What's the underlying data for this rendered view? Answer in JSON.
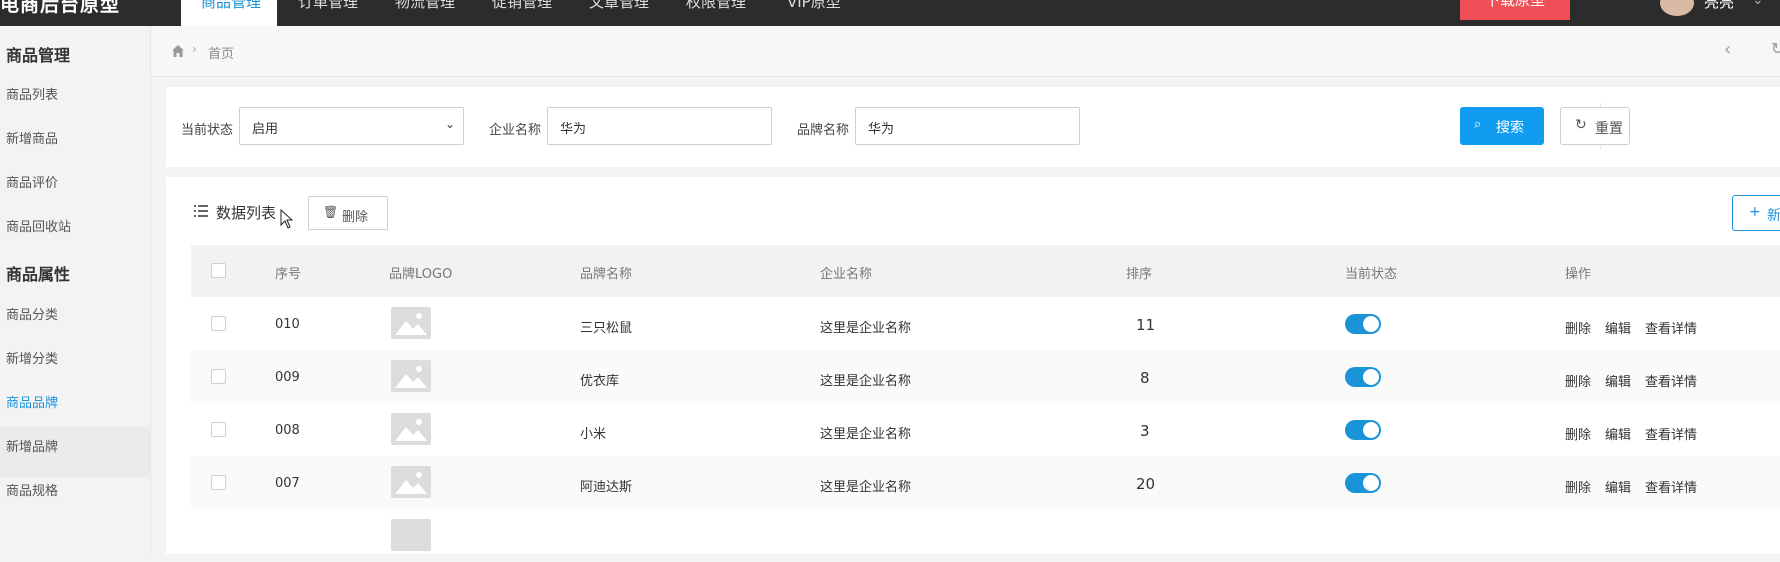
{
  "app": {
    "logo": "电商后台原型",
    "nav_tabs": [
      "商品管理",
      "订单管理",
      "物流管理",
      "促销管理",
      "文章管理",
      "权限管理",
      "VIP原型"
    ],
    "download_label": "下载原型",
    "username": "亮亮"
  },
  "sidebar": {
    "section1": "商品管理",
    "items1": [
      "商品列表",
      "新增商品",
      "商品评价",
      "商品回收站"
    ],
    "section2": "商品属性",
    "items2": [
      "商品分类",
      "新增分类",
      "商品品牌",
      "新增品牌",
      "商品规格"
    ],
    "active_item": "商品品牌"
  },
  "breadcrumb": {
    "home": "首页"
  },
  "filter": {
    "status_label": "当前状态",
    "status_value": "启用",
    "company_label": "企业名称",
    "company_value": "华为",
    "brand_label": "品牌名称",
    "brand_value": "华为",
    "search_label": "搜索",
    "reset_label": "重置"
  },
  "list": {
    "title": "数据列表",
    "delete_label": "删除",
    "add_label": "新增"
  },
  "table": {
    "columns": [
      "序号",
      "品牌LOGO",
      "品牌名称",
      "企业名称",
      "排序",
      "当前状态",
      "操作"
    ],
    "rows": [
      {
        "id": "010",
        "brand": "三只松鼠",
        "company": "这里是企业名称",
        "sort": "11",
        "enabled": true
      },
      {
        "id": "009",
        "brand": "优衣库",
        "company": "这里是企业名称",
        "sort": "8",
        "enabled": true
      },
      {
        "id": "008",
        "brand": "小米",
        "company": "这里是企业名称",
        "sort": "3",
        "enabled": true
      },
      {
        "id": "007",
        "brand": "阿迪达斯",
        "company": "这里是企业名称",
        "sort": "20",
        "enabled": true
      }
    ],
    "actions": [
      "删除",
      "编辑",
      "查看详情"
    ]
  },
  "colors": {
    "accent": "#1a93d8",
    "search_btn": "#0f9cf1",
    "download_btn": "#ef4f56",
    "topbar": "#2c2c2c"
  }
}
